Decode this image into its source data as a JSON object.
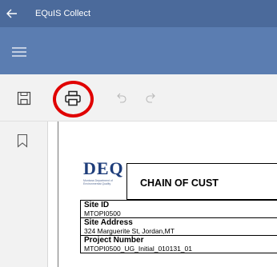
{
  "window": {
    "title": "EQuIS Collect"
  },
  "icons": {
    "back": "back-arrow-icon",
    "menu": "hamburger-menu-icon",
    "save": "save-icon",
    "print": "print-icon",
    "undo": "undo-icon",
    "redo": "redo-icon",
    "bookmark": "bookmark-icon"
  },
  "colors": {
    "titlebar": "#4b6a9b",
    "navband": "#5b7db1",
    "toolbar": "#f2f2f2",
    "highlight": "#e00000",
    "logo": "#1e3d7a"
  },
  "document": {
    "logo_text": "DEQ",
    "logo_subtext": "Montana Department of Environmental Quality",
    "heading": "CHAIN OF CUST",
    "fields": [
      {
        "label": "Site ID",
        "value": "MTOPI0500"
      },
      {
        "label": "Site Address",
        "value": "324 Marguerite St, Jordan,MT"
      },
      {
        "label": "Project Number",
        "value": "MTOPI0500_UG_Initial_010131_01"
      }
    ]
  }
}
